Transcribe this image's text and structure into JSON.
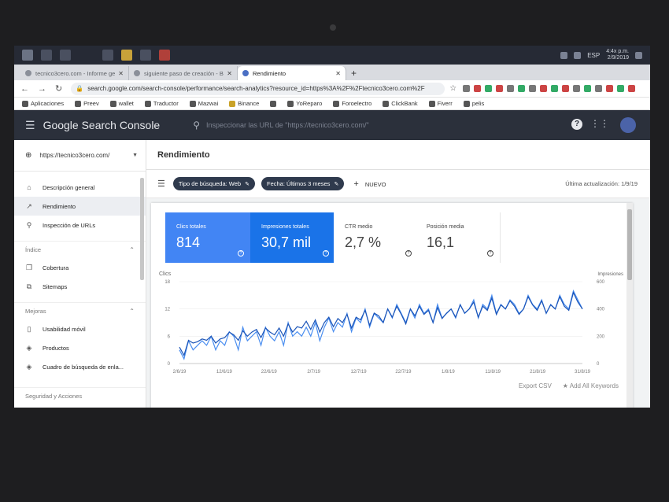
{
  "taskbar": {
    "lang": "ESP",
    "time": "4:4x p.m.",
    "date": "2/9/2019"
  },
  "browser": {
    "tabs": [
      {
        "title": "tecnico3cero.com - Informe general o..."
      },
      {
        "title": "siguiente paso de creación - Bing..."
      },
      {
        "title": "Rendimiento"
      }
    ],
    "url": "search.google.com/search-console/performance/search-analytics?resource_id=https%3A%2F%2Ftecnico3cero.com%2F",
    "bookmarks": [
      "Aplicaciones",
      "Preev",
      "wallet",
      "Traductor",
      "Mazwai",
      "Binance",
      "",
      "YoReparo",
      "Foroelectro",
      "ClickBank",
      "Fiverr",
      "pelis"
    ]
  },
  "gsc": {
    "title": "Google Search Console",
    "search_placeholder": "Inspeccionar las URL de \"https://tecnico3cero.com/\"",
    "property": "https://tecnico3cero.com/",
    "sidebar": {
      "items": [
        {
          "label": "Descripción general",
          "icon": "home-icon"
        },
        {
          "label": "Rendimiento",
          "icon": "trending-icon"
        },
        {
          "label": "Inspección de URLs",
          "icon": "search-icon"
        }
      ],
      "section_index": "Índice",
      "index_items": [
        {
          "label": "Cobertura",
          "icon": "copy-icon"
        },
        {
          "label": "Sitemaps",
          "icon": "sitemap-icon"
        }
      ],
      "section_improvements": "Mejoras",
      "improvement_items": [
        {
          "label": "Usabilidad móvil",
          "icon": "phone-icon"
        },
        {
          "label": "Productos",
          "icon": "layers-icon"
        },
        {
          "label": "Cuadro de búsqueda de enla...",
          "icon": "layers-icon"
        }
      ],
      "section_security": "Seguridad y Acciones"
    },
    "page_title": "Rendimiento",
    "filters": {
      "chip_type": "Tipo de búsqueda: Web",
      "chip_date": "Fecha: Últimos 3 meses",
      "new": "NUEVO",
      "updated": "Última actualización: 1/9/19"
    },
    "metrics": [
      {
        "label": "Clics totales",
        "value": "814",
        "color": "#4285f4"
      },
      {
        "label": "Impresiones totales",
        "value": "30,7 mil",
        "color": "#1a73e8"
      },
      {
        "label": "CTR medio",
        "value": "2,7 %"
      },
      {
        "label": "Posición media",
        "value": "16,1"
      }
    ],
    "footer": {
      "export": "Export CSV",
      "add": "Add All Keywords"
    }
  },
  "chart_data": {
    "type": "line",
    "x_ticks": [
      "2/6/19",
      "12/6/19",
      "22/6/19",
      "2/7/19",
      "12/7/19",
      "22/7/19",
      "1/8/19",
      "11/8/19",
      "21/8/19",
      "31/8/19"
    ],
    "left_axis": {
      "label": "Clics",
      "ticks": [
        0,
        6,
        12,
        18
      ],
      "range": [
        0,
        18
      ]
    },
    "right_axis": {
      "label": "Impresiones",
      "ticks": [
        0,
        200,
        400,
        600
      ],
      "range": [
        0,
        600
      ]
    },
    "series": [
      {
        "name": "Clics",
        "color": "#4a8ef0",
        "values": [
          3,
          1,
          5,
          3,
          4,
          5,
          4,
          6,
          3,
          5,
          4,
          7,
          6,
          3,
          8,
          5,
          6,
          7,
          4,
          8,
          6,
          5,
          7,
          4,
          9,
          6,
          7,
          6,
          8,
          6,
          9,
          5,
          8,
          10,
          7,
          9,
          8,
          11,
          7,
          10,
          9,
          12,
          8,
          11,
          10,
          9,
          12,
          10,
          13,
          11,
          9,
          12,
          10,
          13,
          11,
          12,
          9,
          13,
          10,
          11,
          12,
          10,
          13,
          11,
          12,
          14,
          10,
          13,
          12,
          15,
          11,
          13,
          12,
          14,
          13,
          11,
          12,
          15,
          13,
          12,
          14,
          11,
          13,
          12,
          15,
          13,
          12,
          16,
          14,
          12
        ]
      },
      {
        "name": "Impresiones",
        "color": "#1c55b8",
        "values": [
          120,
          60,
          170,
          150,
          160,
          180,
          170,
          200,
          150,
          180,
          190,
          230,
          210,
          170,
          240,
          200,
          230,
          250,
          190,
          260,
          230,
          210,
          260,
          200,
          290,
          230,
          270,
          260,
          310,
          250,
          320,
          230,
          300,
          340,
          270,
          330,
          300,
          360,
          260,
          340,
          320,
          390,
          280,
          370,
          350,
          300,
          400,
          340,
          420,
          360,
          290,
          400,
          350,
          420,
          360,
          390,
          300,
          410,
          330,
          370,
          400,
          340,
          430,
          370,
          400,
          450,
          340,
          420,
          390,
          480,
          360,
          430,
          400,
          460,
          420,
          360,
          400,
          490,
          430,
          390,
          460,
          370,
          430,
          400,
          490,
          420,
          390,
          520,
          450,
          400
        ]
      }
    ]
  }
}
